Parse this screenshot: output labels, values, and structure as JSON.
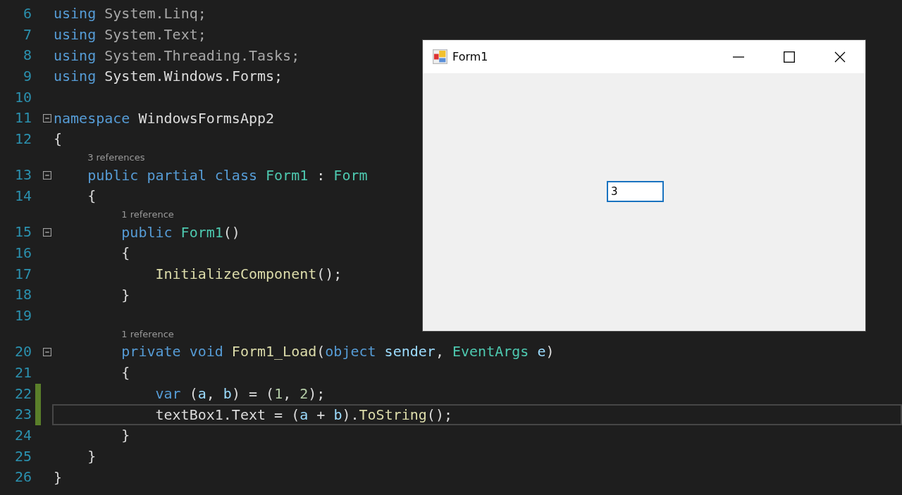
{
  "editor": {
    "lines": [
      {
        "kind": "code",
        "number": "6",
        "fold_marker": false,
        "changed": false,
        "current": false,
        "tokens": [
          {
            "text": "using",
            "kind": "keyword"
          },
          {
            "text": " System.Linq;",
            "kind": "dim"
          }
        ]
      },
      {
        "kind": "code",
        "number": "7",
        "fold_marker": false,
        "changed": false,
        "current": false,
        "tokens": [
          {
            "text": "using",
            "kind": "keyword"
          },
          {
            "text": " System.Text;",
            "kind": "dim"
          }
        ]
      },
      {
        "kind": "code",
        "number": "8",
        "fold_marker": false,
        "changed": false,
        "current": false,
        "tokens": [
          {
            "text": "using",
            "kind": "keyword"
          },
          {
            "text": " System.Threading.Tasks;",
            "kind": "dim"
          }
        ]
      },
      {
        "kind": "code",
        "number": "9",
        "fold_marker": false,
        "changed": false,
        "current": false,
        "tokens": [
          {
            "text": "using",
            "kind": "keyword"
          },
          {
            "text": " System.Windows.Forms;",
            "kind": "plain"
          }
        ]
      },
      {
        "kind": "code",
        "number": "10",
        "fold_marker": false,
        "changed": false,
        "current": false
      },
      {
        "kind": "code",
        "number": "11",
        "fold_marker": true,
        "changed": false,
        "current": false,
        "tokens": [
          {
            "text": "namespace",
            "kind": "keyword"
          },
          {
            "text": " WindowsFormsApp2",
            "kind": "plain"
          }
        ]
      },
      {
        "kind": "code",
        "number": "12",
        "fold_marker": false,
        "changed": false,
        "current": false,
        "tokens": [
          {
            "text": "{",
            "kind": "plain"
          }
        ]
      },
      {
        "kind": "code",
        "number": "13",
        "fold_marker": true,
        "changed": false,
        "current": false,
        "codelens": "3 references",
        "tokens": [
          {
            "text": "    public partial class",
            "kind": "keyword"
          },
          {
            "text": " Form1",
            "kind": "type"
          },
          {
            "text": " : ",
            "kind": "plain"
          },
          {
            "text": "Form",
            "kind": "type"
          }
        ]
      },
      {
        "kind": "code",
        "number": "14",
        "fold_marker": false,
        "changed": false,
        "current": false,
        "tokens": [
          {
            "text": "    {",
            "kind": "plain"
          }
        ]
      },
      {
        "kind": "code",
        "number": "15",
        "fold_marker": true,
        "changed": false,
        "current": false,
        "codelens": "1 reference",
        "tokens": [
          {
            "text": "        public",
            "kind": "keyword"
          },
          {
            "text": " Form1",
            "kind": "type"
          },
          {
            "text": "()",
            "kind": "plain"
          }
        ]
      },
      {
        "kind": "code",
        "number": "16",
        "fold_marker": false,
        "changed": false,
        "current": false,
        "tokens": [
          {
            "text": "        {",
            "kind": "plain"
          }
        ]
      },
      {
        "kind": "code",
        "number": "17",
        "fold_marker": false,
        "changed": false,
        "current": false,
        "tokens": [
          {
            "text": "            InitializeComponent",
            "kind": "method"
          },
          {
            "text": "();",
            "kind": "plain"
          }
        ]
      },
      {
        "kind": "code",
        "number": "18",
        "fold_marker": false,
        "changed": false,
        "current": false,
        "tokens": [
          {
            "text": "        }",
            "kind": "plain"
          }
        ]
      },
      {
        "kind": "code",
        "number": "19",
        "fold_marker": false,
        "changed": false,
        "current": false
      },
      {
        "kind": "code",
        "number": "20",
        "fold_marker": true,
        "changed": false,
        "current": false,
        "codelens": "1 reference",
        "tokens": [
          {
            "text": "        private void",
            "kind": "keyword"
          },
          {
            "text": " Form1_Load",
            "kind": "method"
          },
          {
            "text": "(",
            "kind": "plain"
          },
          {
            "text": "object",
            "kind": "keyword"
          },
          {
            "text": " sender",
            "kind": "variable"
          },
          {
            "text": ", ",
            "kind": "plain"
          },
          {
            "text": "EventArgs",
            "kind": "type"
          },
          {
            "text": " e",
            "kind": "variable"
          },
          {
            "text": ")",
            "kind": "plain"
          }
        ]
      },
      {
        "kind": "code",
        "number": "21",
        "fold_marker": false,
        "changed": false,
        "current": false,
        "tokens": [
          {
            "text": "        {",
            "kind": "plain"
          }
        ]
      },
      {
        "kind": "code",
        "number": "22",
        "fold_marker": false,
        "changed": true,
        "current": false,
        "tokens": [
          {
            "text": "            var",
            "kind": "keyword"
          },
          {
            "text": " (",
            "kind": "plain"
          },
          {
            "text": "a",
            "kind": "variable"
          },
          {
            "text": ", ",
            "kind": "plain"
          },
          {
            "text": "b",
            "kind": "variable"
          },
          {
            "text": ") = (",
            "kind": "plain"
          },
          {
            "text": "1",
            "kind": "number"
          },
          {
            "text": ", ",
            "kind": "plain"
          },
          {
            "text": "2",
            "kind": "number"
          },
          {
            "text": ");",
            "kind": "plain"
          }
        ]
      },
      {
        "kind": "code",
        "number": "23",
        "fold_marker": false,
        "changed": true,
        "current": true,
        "tokens": [
          {
            "text": "            textBox1.Text = (",
            "kind": "plain"
          },
          {
            "text": "a",
            "kind": "variable"
          },
          {
            "text": " + ",
            "kind": "plain"
          },
          {
            "text": "b",
            "kind": "variable"
          },
          {
            "text": ").",
            "kind": "plain"
          },
          {
            "text": "ToString",
            "kind": "method"
          },
          {
            "text": "();",
            "kind": "plain"
          }
        ]
      },
      {
        "kind": "code",
        "number": "24",
        "fold_marker": false,
        "changed": false,
        "current": false,
        "tokens": [
          {
            "text": "        }",
            "kind": "plain"
          }
        ]
      },
      {
        "kind": "code",
        "number": "25",
        "fold_marker": false,
        "changed": false,
        "current": false,
        "tokens": [
          {
            "text": "    }",
            "kind": "plain"
          }
        ]
      },
      {
        "kind": "code",
        "number": "26",
        "fold_marker": false,
        "changed": false,
        "current": false,
        "tokens": [
          {
            "text": "}",
            "kind": "plain"
          }
        ]
      }
    ]
  },
  "form_window": {
    "title": "Form1",
    "text_box": {
      "value": "3"
    }
  }
}
